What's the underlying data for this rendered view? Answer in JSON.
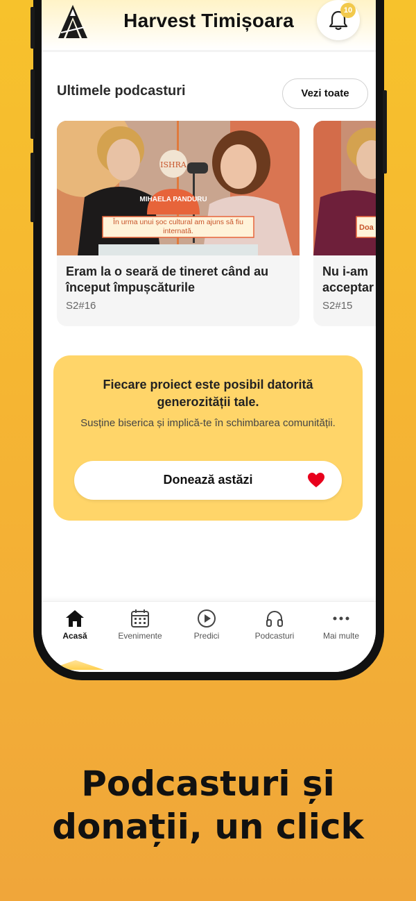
{
  "header": {
    "title": "Harvest Timișoara",
    "notification_count": "10"
  },
  "podcasts": {
    "section_title": "Ultimele podcasturi",
    "see_all_label": "Vezi toate",
    "items": [
      {
        "title": "Eram la o seară de tineret când au început împușcăturile",
        "episode": "S2#16",
        "thumb_logo": "ISHRA",
        "guest_name": "MIHAELA PANDURU",
        "quote": "În urma unui șoc cultural am ajuns să fiu internată."
      },
      {
        "title": "Nu i-am acceptar",
        "episode": "S2#15",
        "quote": "Doa"
      }
    ]
  },
  "donation": {
    "headline": "Fiecare proiect este posibil datorită generozității tale.",
    "subtext": "Susține biserica și implică-te în schimbarea comunității.",
    "button_label": "Donează astăzi"
  },
  "tabbar": {
    "items": [
      {
        "label": "Acasă",
        "icon": "home-icon",
        "active": true
      },
      {
        "label": "Evenimente",
        "icon": "calendar-icon"
      },
      {
        "label": "Predici",
        "icon": "play-icon"
      },
      {
        "label": "Podcasturi",
        "icon": "headphones-icon"
      },
      {
        "label": "Mai multe",
        "icon": "more-icon"
      }
    ]
  },
  "tagline": {
    "line1": "Podcasturi și",
    "line2": "donații, un click"
  },
  "colors": {
    "background": "#f5b533",
    "accent": "#ffd569",
    "heart": "#e8001c",
    "badge": "#f2c94c"
  }
}
